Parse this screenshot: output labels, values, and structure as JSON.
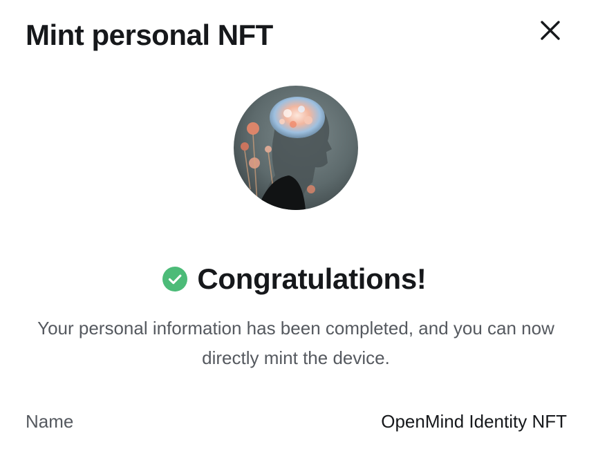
{
  "dialog": {
    "title": "Mint personal NFT",
    "close_icon": "close-icon"
  },
  "avatar": {
    "icon": "nft-artwork-avatar",
    "accent_colors": [
      "#f2a58a",
      "#8fb7d8",
      "#2b2f33"
    ]
  },
  "status": {
    "icon": "check-circle-icon",
    "icon_color": "#4cbb78",
    "title": "Congratulations!",
    "message": "Your personal information has been completed, and you can now directly mint the device."
  },
  "details": [
    {
      "label": "Name",
      "value": "OpenMind Identity NFT"
    }
  ]
}
